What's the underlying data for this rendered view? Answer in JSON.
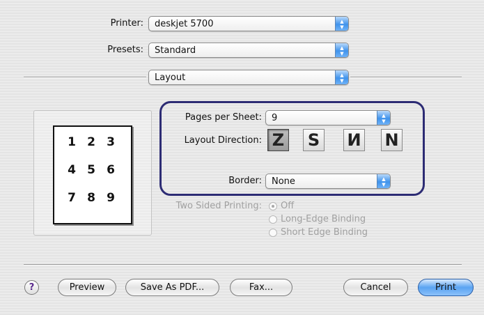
{
  "printer": {
    "label": "Printer:",
    "value": "deskjet 5700"
  },
  "presets": {
    "label": "Presets:",
    "value": "Standard"
  },
  "panel": {
    "value": "Layout"
  },
  "preview_numbers": [
    "1",
    "2",
    "3",
    "4",
    "5",
    "6",
    "7",
    "8",
    "9"
  ],
  "pages_per_sheet": {
    "label": "Pages per Sheet:",
    "value": "9"
  },
  "layout_direction": {
    "label": "Layout Direction:",
    "options": [
      {
        "glyph": "Z",
        "icon": "z-order-icon"
      },
      {
        "glyph": "S",
        "icon": "reverse-z-order-icon"
      },
      {
        "glyph": "И",
        "icon": "reverse-n-order-icon"
      },
      {
        "glyph": "N",
        "icon": "n-order-icon"
      }
    ]
  },
  "border": {
    "label": "Border:",
    "value": "None"
  },
  "two_sided": {
    "label": "Two Sided Printing:",
    "options": [
      "Off",
      "Long-Edge Binding",
      "Short Edge Binding"
    ]
  },
  "buttons": {
    "help": "?",
    "preview": "Preview",
    "save_pdf": "Save As PDF...",
    "fax": "Fax...",
    "cancel": "Cancel",
    "print": "Print"
  },
  "colors": {
    "callout": "#2d2c74",
    "accent": "#3f93ec"
  }
}
